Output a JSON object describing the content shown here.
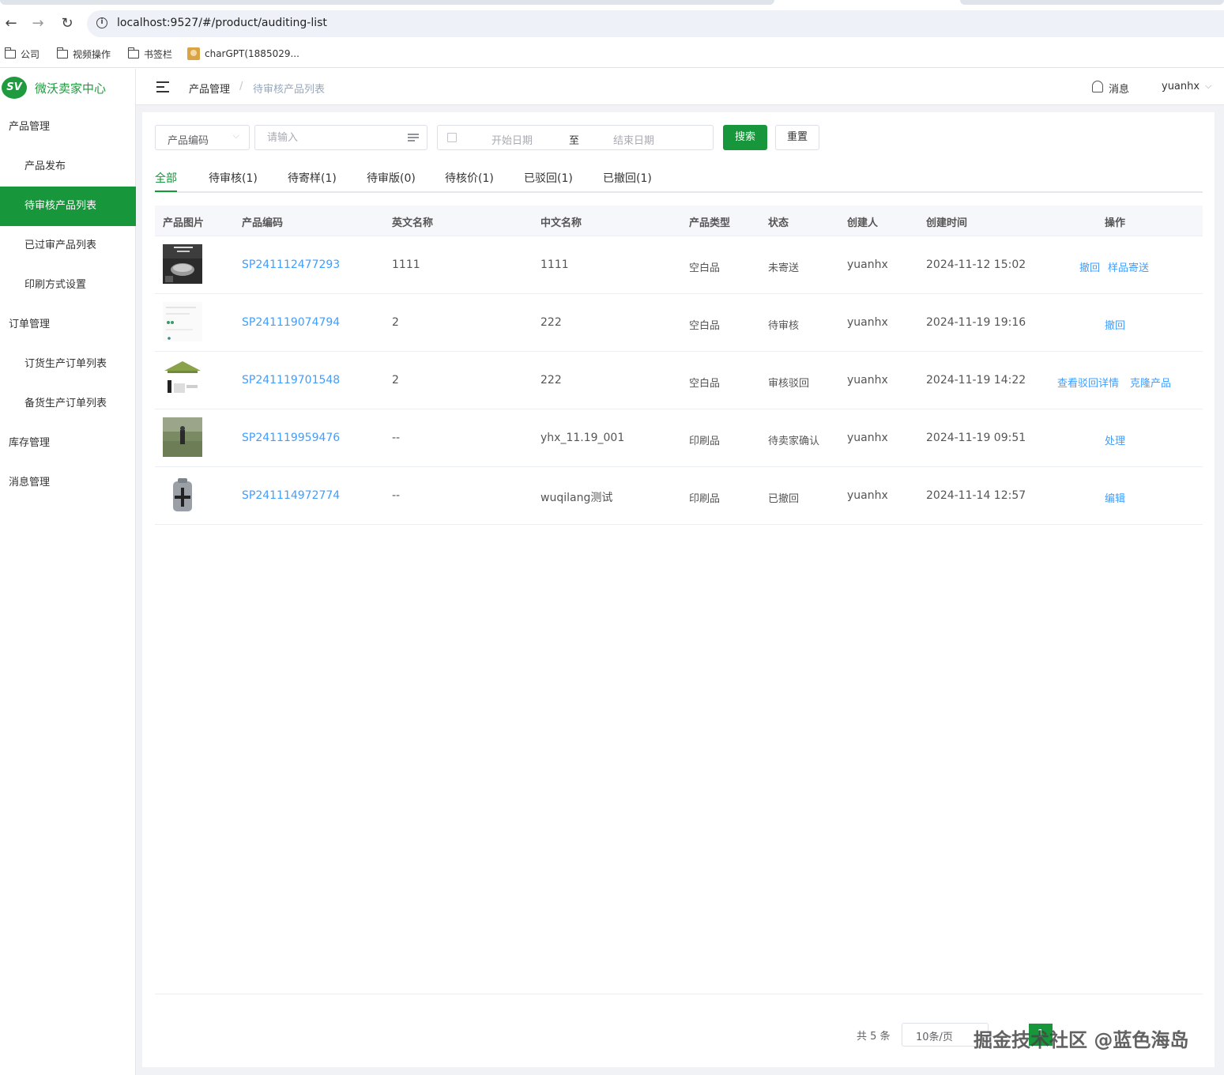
{
  "browser": {
    "url": "localhost:9527/#/product/auditing-list",
    "bookmarks": [
      "公司",
      "视频操作",
      "书签栏",
      "charGPT(1885029..."
    ]
  },
  "sidebar": {
    "logo_badge": "SV",
    "logo_text": "微沃卖家中心",
    "groups": [
      {
        "label": "产品管理",
        "items": [
          "产品发布",
          "待审核产品列表",
          "已过审产品列表",
          "印刷方式设置"
        ]
      },
      {
        "label": "订单管理",
        "items": [
          "订货生产订单列表",
          "备货生产订单列表"
        ]
      },
      {
        "label": "库存管理",
        "items": []
      },
      {
        "label": "消息管理",
        "items": []
      }
    ],
    "active_item": "待审核产品列表"
  },
  "header": {
    "breadcrumb": [
      "产品管理",
      "待审核产品列表"
    ],
    "breadcrumb_sep": "/",
    "messages_label": "消息",
    "username": "yuanhx"
  },
  "filters": {
    "select_value": "产品编码",
    "keyword_placeholder": "请输入",
    "start_placeholder": "开始日期",
    "range_sep": "至",
    "end_placeholder": "结束日期",
    "search_label": "搜索",
    "reset_label": "重置"
  },
  "tabs": [
    "全部",
    "待审核(1)",
    "待寄样(1)",
    "待审版(0)",
    "待核价(1)",
    "已驳回(1)",
    "已撤回(1)"
  ],
  "active_tab": "全部",
  "table": {
    "columns": [
      "产品图片",
      "产品编码",
      "英文名称",
      "中文名称",
      "产品类型",
      "状态",
      "创建人",
      "创建时间",
      "操作"
    ],
    "rows": [
      {
        "code": "SP241112477293",
        "en": "1111",
        "cn": "1111",
        "type": "空白品",
        "status": "未寄送",
        "creator": "yuanhx",
        "time": "2024-11-12 15:02",
        "actions": [
          "撤回",
          "样品寄送"
        ]
      },
      {
        "code": "SP241119074794",
        "en": "2",
        "cn": "222",
        "type": "空白品",
        "status": "待审核",
        "creator": "yuanhx",
        "time": "2024-11-19 19:16",
        "actions": [
          "撤回"
        ]
      },
      {
        "code": "SP241119701548",
        "en": "2",
        "cn": "222",
        "type": "空白品",
        "status": "审核驳回",
        "creator": "yuanhx",
        "time": "2024-11-19 14:22",
        "actions": [
          "查看驳回详情",
          "克隆产品"
        ]
      },
      {
        "code": "SP241119959476",
        "en": "--",
        "cn": "yhx_11.19_001",
        "type": "印刷品",
        "status": "待卖家确认",
        "creator": "yuanhx",
        "time": "2024-11-19 09:51",
        "actions": [
          "处理"
        ]
      },
      {
        "code": "SP241114972774",
        "en": "--",
        "cn": "wuqilang测试",
        "type": "印刷品",
        "status": "已撤回",
        "creator": "yuanhx",
        "time": "2024-11-14 12:57",
        "actions": [
          "编辑"
        ]
      }
    ]
  },
  "pagination": {
    "total_label": "共 5 条",
    "page_size_label": "10条/页",
    "current_page": "1"
  },
  "watermark": "掘金技术社区 @蓝色海岛",
  "colors": {
    "brand": "#17963b",
    "link": "#409eff"
  }
}
